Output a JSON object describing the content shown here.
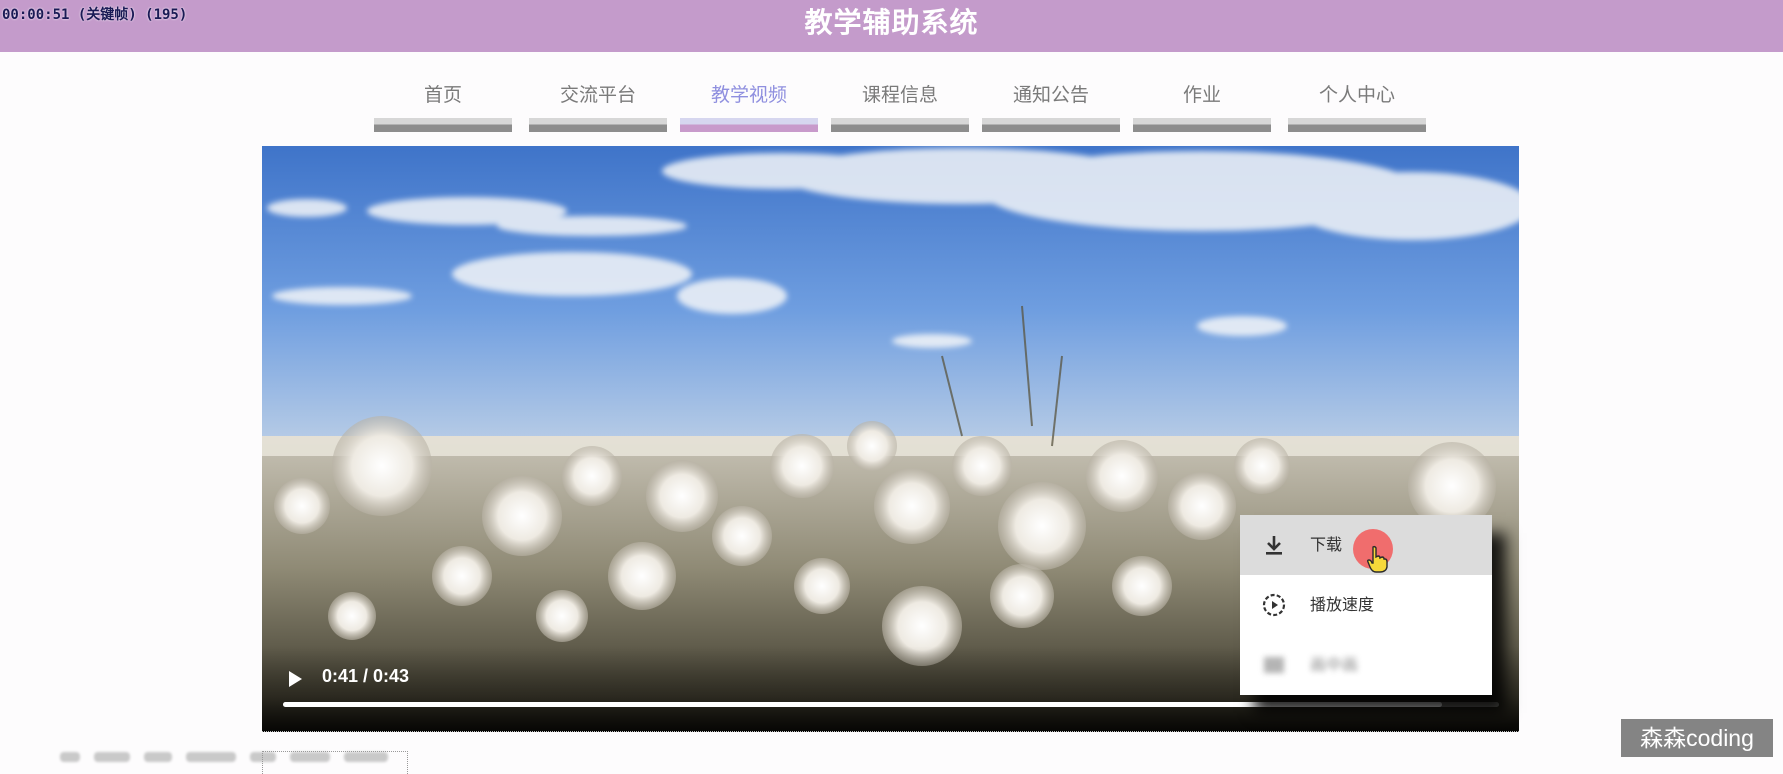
{
  "recording": {
    "timer": "00:00:51 (关键帧) (195)"
  },
  "header": {
    "title": "教学辅助系统"
  },
  "nav": {
    "items": [
      {
        "label": "首页"
      },
      {
        "label": "交流平台"
      },
      {
        "label": "教学视频",
        "active": true
      },
      {
        "label": "课程信息"
      },
      {
        "label": "通知公告"
      },
      {
        "label": "作业"
      },
      {
        "label": "个人中心"
      }
    ]
  },
  "video": {
    "time_display": "0:41 / 0:43",
    "current_seconds": 41,
    "duration_seconds": 43,
    "progress_fraction": 0.953
  },
  "context_menu": {
    "items": [
      {
        "label": "下载",
        "icon": "download-icon",
        "hovered": true
      },
      {
        "label": "播放速度",
        "icon": "playback-speed-icon"
      },
      {
        "label": "画中画",
        "icon": "picture-in-picture-icon",
        "faded": true
      }
    ]
  },
  "watermark": {
    "text": "森森coding"
  },
  "colors": {
    "header_bg": "#c49bcb",
    "nav_active_text": "#8f8fdf",
    "nav_text": "#7a7a7a",
    "cursor_highlight": "#f26060"
  }
}
